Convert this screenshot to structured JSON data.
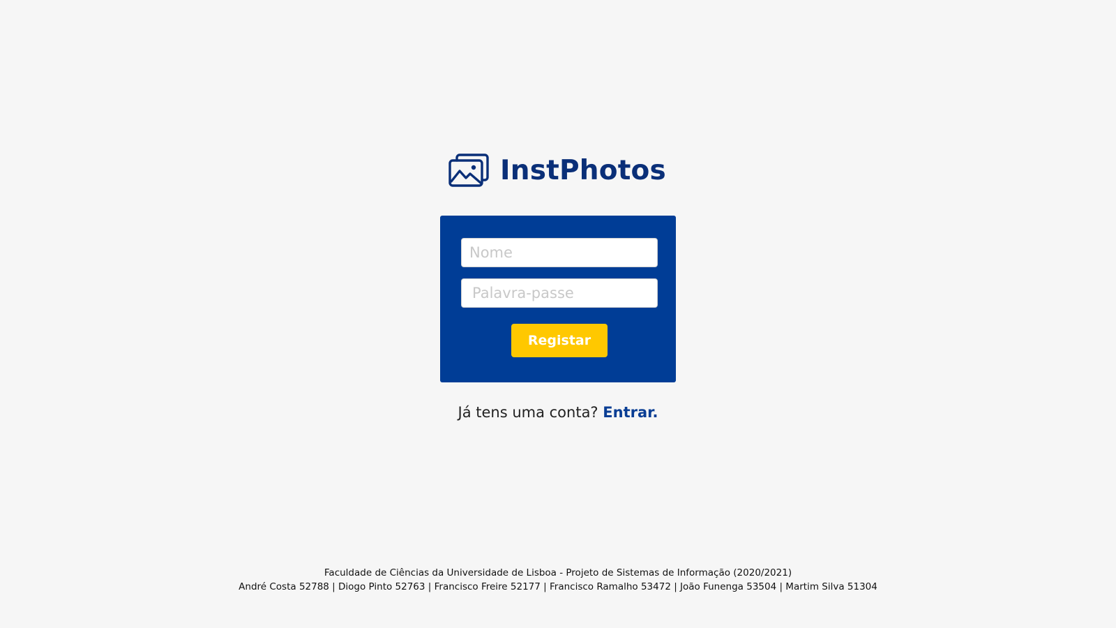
{
  "brand": {
    "title": "InstPhotos",
    "icon": "photos-icon",
    "color": "#0a2f78"
  },
  "form": {
    "name_placeholder": "Nome",
    "password_placeholder": "Palavra-passe",
    "submit_label": "Registar",
    "card_color": "#003d96",
    "button_color": "#ffc800"
  },
  "signin": {
    "prompt": "Já tens uma conta?",
    "link_label": "Entrar."
  },
  "footer": {
    "line1": "Faculdade de Ciências da Universidade de Lisboa - Projeto de Sistemas de Informação (2020/2021)",
    "line2": "André Costa 52788 | Diogo Pinto 52763 | Francisco Freire 52177 | Francisco Ramalho 53472 | João Funenga 53504 | Martim Silva 51304"
  }
}
